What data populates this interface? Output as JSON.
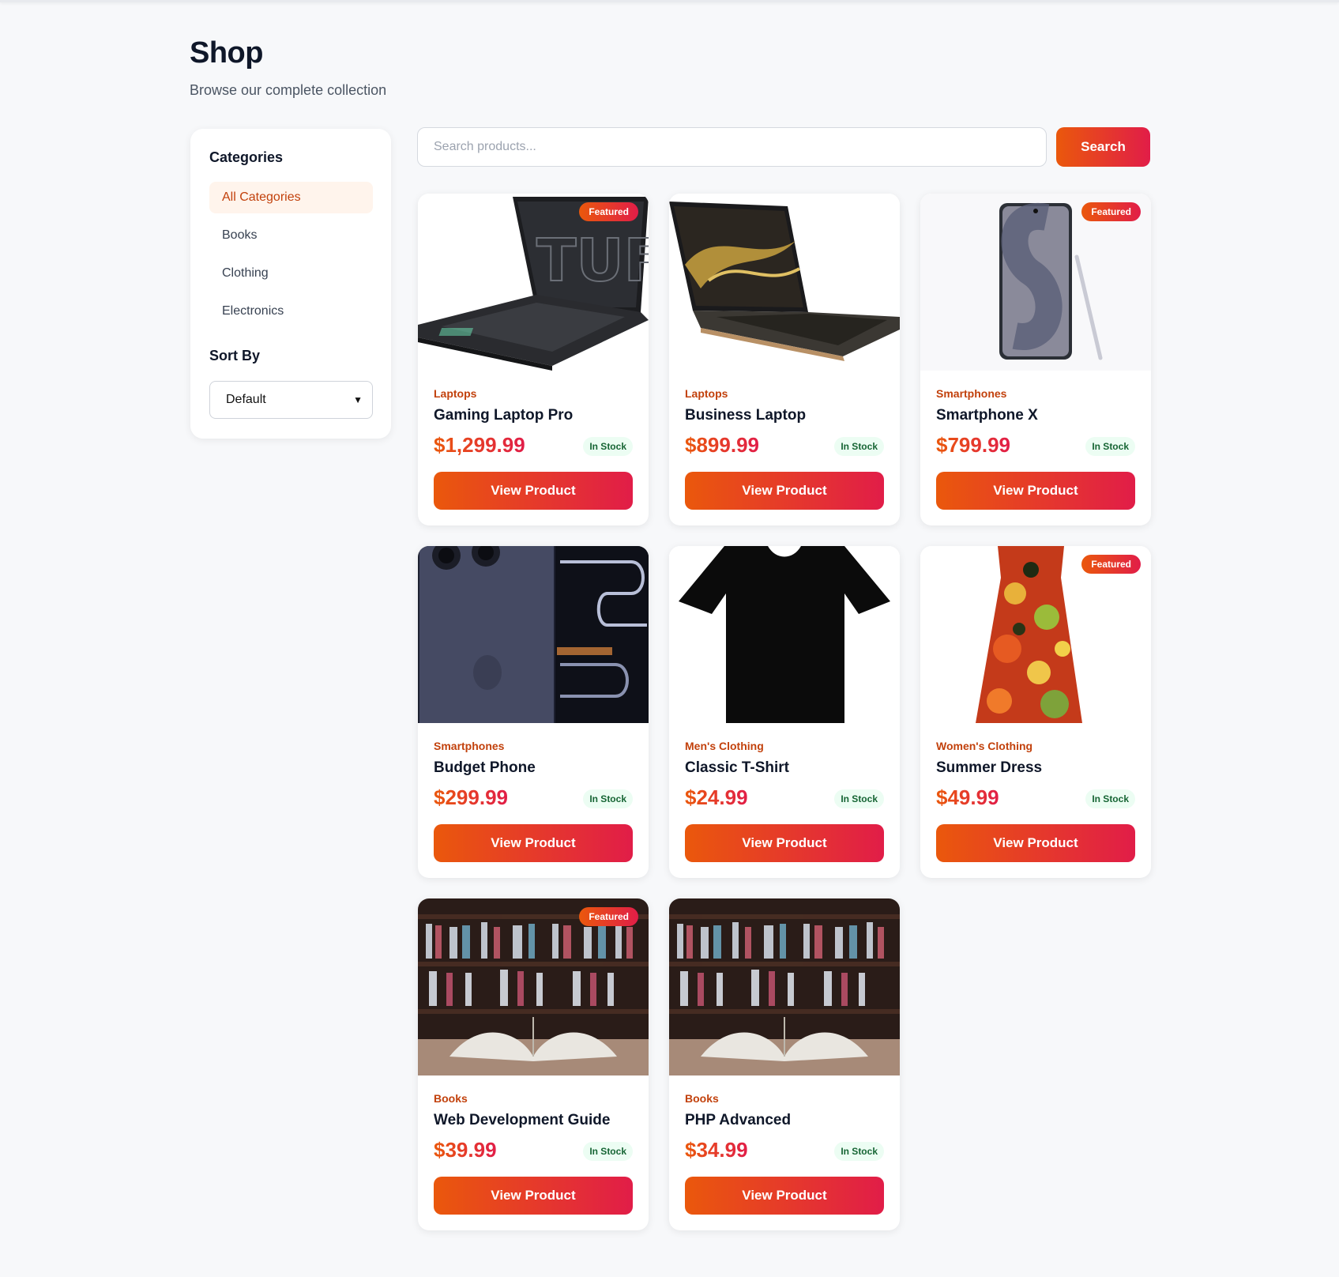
{
  "page": {
    "title": "Shop",
    "subtitle": "Browse our complete collection"
  },
  "sidebar": {
    "categories_heading": "Categories",
    "categories": [
      {
        "label": "All Categories",
        "active": true
      },
      {
        "label": "Books",
        "active": false
      },
      {
        "label": "Clothing",
        "active": false
      },
      {
        "label": "Electronics",
        "active": false
      }
    ],
    "sort_heading": "Sort By",
    "sort_value": "Default"
  },
  "search": {
    "placeholder": "Search products...",
    "button_label": "Search"
  },
  "products": [
    {
      "category": "Laptops",
      "name": "Gaming Laptop Pro",
      "price": "$1,299.99",
      "stock": "In Stock",
      "featured": true,
      "badge": "Featured",
      "button": "View Product",
      "image": "gaming-laptop-image"
    },
    {
      "category": "Laptops",
      "name": "Business Laptop",
      "price": "$899.99",
      "stock": "In Stock",
      "featured": false,
      "badge": "",
      "button": "View Product",
      "image": "business-laptop-image"
    },
    {
      "category": "Smartphones",
      "name": "Smartphone X",
      "price": "$799.99",
      "stock": "In Stock",
      "featured": true,
      "badge": "Featured",
      "button": "View Product",
      "image": "smartphone-image"
    },
    {
      "category": "Smartphones",
      "name": "Budget Phone",
      "price": "$299.99",
      "stock": "In Stock",
      "featured": false,
      "badge": "",
      "button": "View Product",
      "image": "budget-phone-image"
    },
    {
      "category": "Men's Clothing",
      "name": "Classic T-Shirt",
      "price": "$24.99",
      "stock": "In Stock",
      "featured": false,
      "badge": "",
      "button": "View Product",
      "image": "tshirt-image"
    },
    {
      "category": "Women's Clothing",
      "name": "Summer Dress",
      "price": "$49.99",
      "stock": "In Stock",
      "featured": true,
      "badge": "Featured",
      "button": "View Product",
      "image": "dress-image"
    },
    {
      "category": "Books",
      "name": "Web Development Guide",
      "price": "$39.99",
      "stock": "In Stock",
      "featured": true,
      "badge": "Featured",
      "button": "View Product",
      "image": "book-image"
    },
    {
      "category": "Books",
      "name": "PHP Advanced",
      "price": "$34.99",
      "stock": "In Stock",
      "featured": false,
      "badge": "",
      "button": "View Product",
      "image": "book-image"
    }
  ],
  "colors": {
    "accent_start": "#ea580c",
    "accent_end": "#e11d48",
    "stock_bg": "#ecfdf3",
    "stock_text": "#166534"
  }
}
